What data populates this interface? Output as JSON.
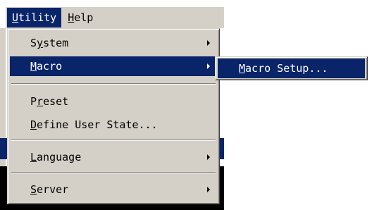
{
  "menubar": {
    "utility": {
      "mnemonic": "U",
      "rest": "tility"
    },
    "help": {
      "mnemonic": "H",
      "rest": "elp"
    }
  },
  "utility_menu": {
    "items": [
      {
        "pre": "S",
        "mnemonic": "y",
        "rest": "stem",
        "submenu": true,
        "highlighted": false
      },
      {
        "pre": "",
        "mnemonic": "M",
        "rest": "acro",
        "submenu": true,
        "highlighted": true
      },
      {
        "pre": "P",
        "mnemonic": "r",
        "rest": "eset",
        "submenu": false,
        "highlighted": false
      },
      {
        "pre": "",
        "mnemonic": "D",
        "rest": "efine User State...",
        "submenu": false,
        "highlighted": false
      },
      {
        "pre": "",
        "mnemonic": "L",
        "rest": "anguage",
        "submenu": true,
        "highlighted": false
      },
      {
        "pre": "",
        "mnemonic": "S",
        "rest": "erver",
        "submenu": true,
        "highlighted": false
      }
    ]
  },
  "macro_submenu": {
    "items": [
      {
        "pre": "",
        "mnemonic": "M",
        "rest": "acro Setup...",
        "highlighted": true
      }
    ]
  },
  "colors": {
    "highlight": "#0a246a",
    "menu_face": "#d4d0c8"
  }
}
